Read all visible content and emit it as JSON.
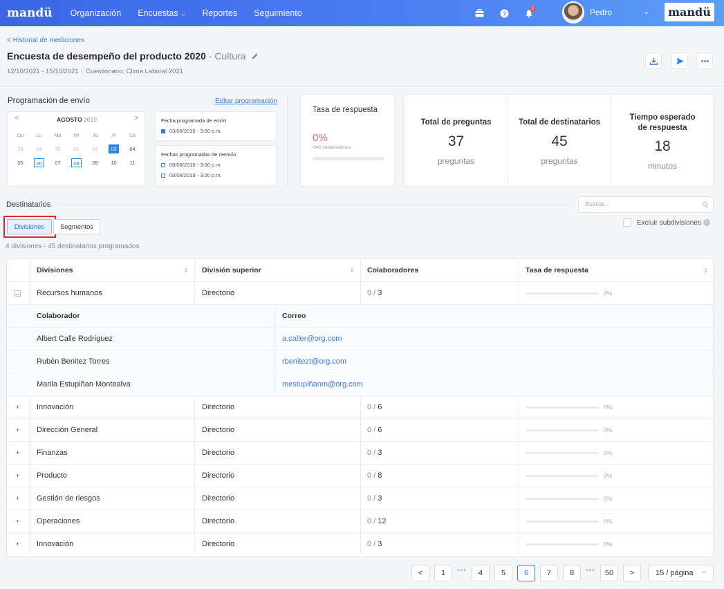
{
  "topbar": {
    "logo": "mandü",
    "nav": [
      {
        "label": "Organización",
        "dropdown": false
      },
      {
        "label": "Encuestas",
        "dropdown": true
      },
      {
        "label": "Reportes",
        "dropdown": false
      },
      {
        "label": "Seguimiento",
        "dropdown": false
      }
    ],
    "icons": [
      "briefcase-icon",
      "help-icon",
      "bell-icon"
    ],
    "notification_count": "3",
    "user_name": "Pedro",
    "brand_logo": "mandü",
    "colors": {
      "gradient_start": "#3a66e6",
      "gradient_end": "#5aa0f7"
    }
  },
  "header": {
    "breadcrumb": "< Historial de mediciones",
    "title": "Encuesta de desempeño del producto 2020",
    "title_suffix": "- Cultura",
    "date_range": "12/10/2021 - 15/10/2021",
    "questionnaire": "Cuestionario: Clima Laboral 2021",
    "actions": [
      "download-icon",
      "send-icon",
      "more-icon"
    ]
  },
  "schedule": {
    "title": "Programación de envío",
    "edit_link": "Editar programación",
    "calendar": {
      "month": "AGOSTO",
      "year": "2019",
      "prev": "<",
      "next": ">",
      "weekdays": [
        "Do",
        "Lu",
        "Ma",
        "Mi",
        "Ju",
        "Vi",
        "Sa"
      ],
      "weeks": [
        [
          "28",
          "29",
          "30",
          "01",
          "02",
          "03",
          "04"
        ],
        [
          "05",
          "06",
          "07",
          "08",
          "09",
          "10",
          "11"
        ]
      ],
      "selected": "03",
      "outlined": [
        "06",
        "08"
      ],
      "muted": [
        "28",
        "29",
        "30",
        "01",
        "02"
      ]
    },
    "send_date": {
      "title": "Fecha programada de envío",
      "date": "03/08/2019 - 3:00 p.m."
    },
    "resend_dates": {
      "title": "Fechas programadas de reenvío",
      "dates": [
        "06/08/2019 - 3:00 p.m.",
        "08/08/2019 - 3:00 p.m."
      ]
    }
  },
  "response_rate": {
    "title": "Tasa de respuesta",
    "value": "0%",
    "detail": "0/45 colaboradores",
    "progress": 0,
    "color": "#e0666b"
  },
  "stats": [
    {
      "label": "Total de preguntas",
      "value": "37",
      "unit": "preguntas"
    },
    {
      "label": "Total de destinatarios",
      "value": "45",
      "unit": "preguntas"
    },
    {
      "label": "Tiempo esperado de respuesta",
      "value": "18",
      "unit": "minutos"
    }
  ],
  "recipients": {
    "title": "Destinatarios",
    "search_placeholder": "Buscar...",
    "tabs": [
      {
        "label": "Divisiones",
        "active": true
      },
      {
        "label": "Segmentos",
        "active": false
      }
    ],
    "exclude_label": "Excluir subdivisiones",
    "summary": "4 divisiones - 45 destinatarios programados",
    "columns": [
      "Divisiones",
      "División superior",
      "Colaboradores",
      "Tasa de respuesta"
    ],
    "rows": [
      {
        "division": "Recursos humanos",
        "parent": "Directorio",
        "done": "0",
        "total": "3",
        "rate": "0%",
        "expanded": true
      },
      {
        "division": "Innovación",
        "parent": "Directorio",
        "done": "0",
        "total": "6",
        "rate": "0%",
        "expanded": false
      },
      {
        "division": "Dirección General",
        "parent": "Directorio",
        "done": "0",
        "total": "6",
        "rate": "0%",
        "expanded": false
      },
      {
        "division": "Finanzas",
        "parent": "Directorio",
        "done": "0",
        "total": "3",
        "rate": "0%",
        "expanded": false
      },
      {
        "division": "Producto",
        "parent": "Directorio",
        "done": "0",
        "total": "8",
        "rate": "0%",
        "expanded": false
      },
      {
        "division": "Gestión de riesgos",
        "parent": "Directorio",
        "done": "0",
        "total": "3",
        "rate": "0%",
        "expanded": false
      },
      {
        "division": "Operaciones",
        "parent": "Directorio",
        "done": "0",
        "total": "12",
        "rate": "0%",
        "expanded": false
      },
      {
        "division": "Innovación",
        "parent": "Directorio",
        "done": "0",
        "total": "3",
        "rate": "0%",
        "expanded": false
      }
    ],
    "sub_columns": [
      "Colaborador",
      "Correo"
    ],
    "sub_rows": [
      {
        "name": "Albert Calle Rodriguez",
        "email": "a.caller@org.com"
      },
      {
        "name": "Rubén Benitez Torres",
        "email": "rbenitezt@org.com"
      },
      {
        "name": "Marila Estupiñan Montealva",
        "email": "mestupiñanm@org.com"
      }
    ]
  },
  "pagination": {
    "prev": "<",
    "next": ">",
    "pages": [
      "1",
      "4",
      "5",
      "6",
      "7",
      "8",
      "50"
    ],
    "current": "6",
    "ellipsis": "•••",
    "page_size": "15 / página"
  }
}
